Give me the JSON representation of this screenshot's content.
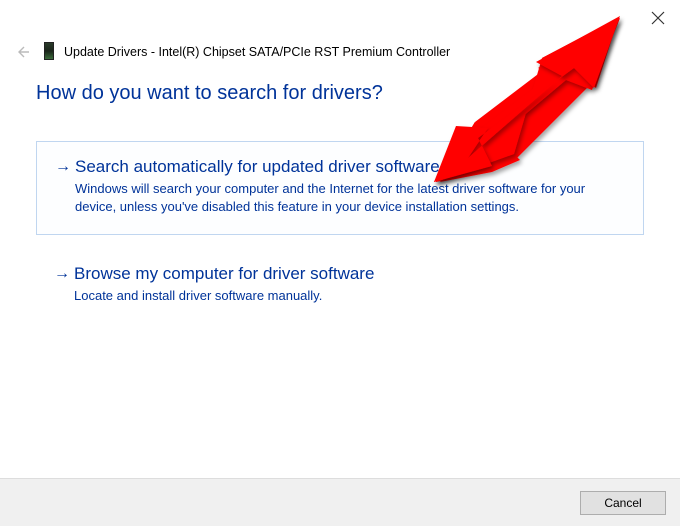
{
  "window": {
    "title": "Update Drivers - Intel(R) Chipset SATA/PCIe RST Premium Controller"
  },
  "heading": "How do you want to search for drivers?",
  "options": [
    {
      "title": "Search automatically for updated driver software",
      "desc": "Windows will search your computer and the Internet for the latest driver software for your device, unless you've disabled this feature in your device installation settings."
    },
    {
      "title": "Browse my computer for driver software",
      "desc": "Locate and install driver software manually."
    }
  ],
  "footer": {
    "cancel_label": "Cancel"
  },
  "icons": {
    "back": "back-arrow-icon",
    "close": "close-icon",
    "device": "chipset-icon",
    "option_arrow": "right-arrow-icon"
  },
  "annotation": {
    "arrow_color": "#ff0000"
  }
}
